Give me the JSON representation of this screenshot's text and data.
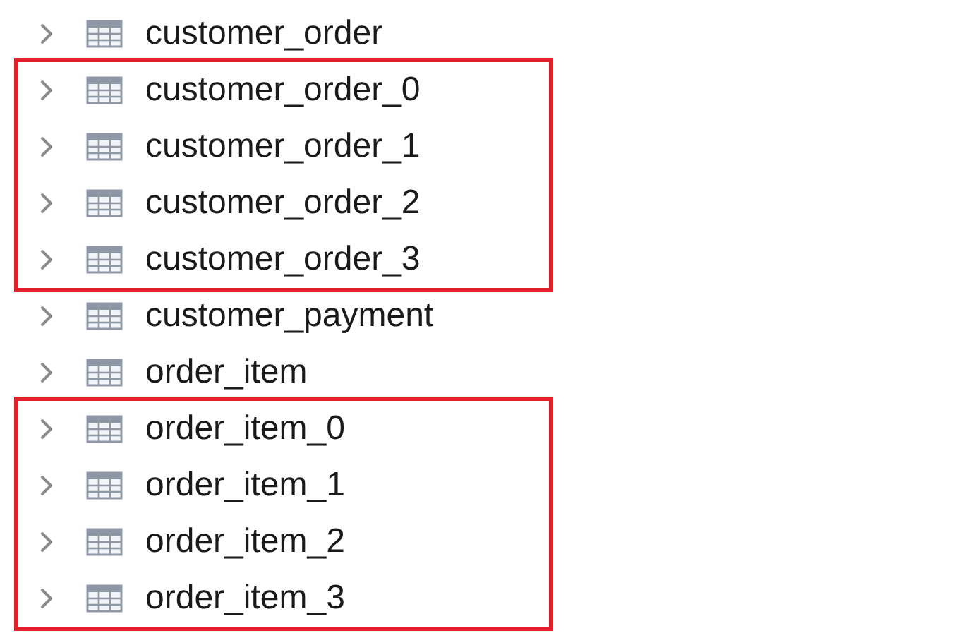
{
  "groups": [
    {
      "highlighted": false,
      "rows": [
        {
          "label": "customer_order"
        }
      ]
    },
    {
      "highlighted": true,
      "rows": [
        {
          "label": "customer_order_0"
        },
        {
          "label": "customer_order_1"
        },
        {
          "label": "customer_order_2"
        },
        {
          "label": "customer_order_3"
        }
      ]
    },
    {
      "highlighted": false,
      "rows": [
        {
          "label": "customer_payment"
        },
        {
          "label": "order_item"
        }
      ]
    },
    {
      "highlighted": true,
      "rows": [
        {
          "label": "order_item_0"
        },
        {
          "label": "order_item_1"
        },
        {
          "label": "order_item_2"
        },
        {
          "label": "order_item_3"
        }
      ]
    }
  ]
}
